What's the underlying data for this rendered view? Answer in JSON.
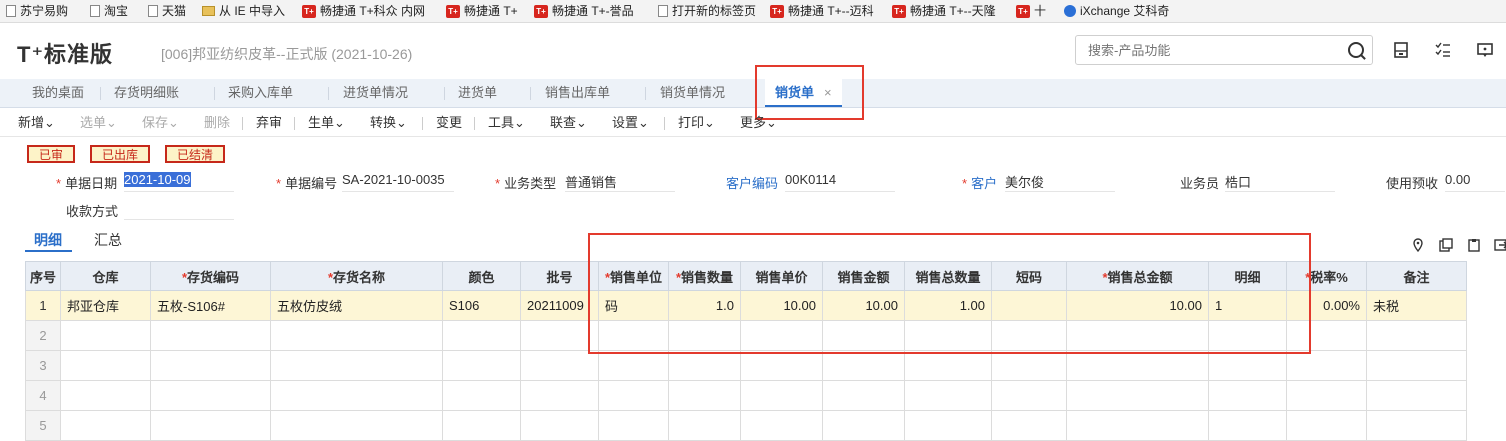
{
  "bookmarks": [
    {
      "label": "苏宁易购",
      "icon": "page-icon"
    },
    {
      "label": "淘宝",
      "icon": "page-icon"
    },
    {
      "label": "天猫",
      "icon": "page-icon"
    },
    {
      "label": "从 IE 中导入",
      "icon": "folder-icon"
    },
    {
      "label": "畅捷通 T+科众 内网",
      "icon": "tplus-icon"
    },
    {
      "label": "畅捷通 T+",
      "icon": "tplus-icon"
    },
    {
      "label": "畅捷通 T+-誉品",
      "icon": "tplus-icon"
    },
    {
      "label": "打开新的标签页",
      "icon": "page-icon"
    },
    {
      "label": "畅捷通 T+--迈科",
      "icon": "tplus-icon"
    },
    {
      "label": "畅捷通 T+--天隆",
      "icon": "tplus-icon"
    },
    {
      "label": "十",
      "icon": "tplus-icon"
    },
    {
      "label": "iXchange 艾科奇",
      "icon": "ixchange-icon"
    }
  ],
  "header": {
    "logo": "T⁺标准版",
    "company": "[006]邦亚纺织皮革--正式版 (2021-10-26)",
    "search_placeholder": "搜索-产品功能"
  },
  "tabs": [
    "我的桌面",
    "存货明细账",
    "采购入库单",
    "进货单情况",
    "进货单",
    "销售出库单",
    "销货单情况",
    "销货单"
  ],
  "active_tab": "销货单",
  "tab_close": "×",
  "toolbar": [
    {
      "label": "新增",
      "disabled": false
    },
    {
      "label": "选单",
      "disabled": true
    },
    {
      "label": "保存",
      "disabled": true
    },
    {
      "label": "删除",
      "disabled": true
    },
    {
      "label": "弃审",
      "disabled": false
    },
    {
      "label": "生单",
      "disabled": false
    },
    {
      "label": "转换",
      "disabled": false
    },
    {
      "label": "变更",
      "disabled": false
    },
    {
      "label": "工具",
      "disabled": false
    },
    {
      "label": "联查",
      "disabled": false
    },
    {
      "label": "设置",
      "disabled": false
    },
    {
      "label": "打印",
      "disabled": false
    },
    {
      "label": "更多",
      "disabled": false
    }
  ],
  "stamps": [
    "已审",
    "已出库",
    "已结清"
  ],
  "form": {
    "date_label": "单据日期",
    "date_value": "2021-10-09",
    "code_label": "单据编号",
    "code_value": "SA-2021-10-0035",
    "biztype_label": "业务类型",
    "biztype_value": "普通销售",
    "custcode_label": "客户编码",
    "custcode_value": "00K0114",
    "customer_label": "客户",
    "customer_value": "美尔俊",
    "salesman_label": "业务员",
    "salesman_value": "梏口",
    "prepay_label": "使用预收",
    "prepay_value": "0.00",
    "payment_label": "收款方式",
    "payment_value": ""
  },
  "subtabs": [
    "明细",
    "汇总"
  ],
  "grid": {
    "columns": [
      {
        "label": "序号",
        "required": false
      },
      {
        "label": "仓库",
        "required": false
      },
      {
        "label": "存货编码",
        "required": true
      },
      {
        "label": "存货名称",
        "required": true
      },
      {
        "label": "颜色",
        "required": false
      },
      {
        "label": "批号",
        "required": false
      },
      {
        "label": "销售单位",
        "required": true
      },
      {
        "label": "销售数量",
        "required": true
      },
      {
        "label": "销售单价",
        "required": false
      },
      {
        "label": "销售金额",
        "required": false
      },
      {
        "label": "销售总数量",
        "required": false
      },
      {
        "label": "短码",
        "required": false
      },
      {
        "label": "销售总金额",
        "required": true
      },
      {
        "label": "明细",
        "required": false
      },
      {
        "label": "税率%",
        "required": true
      },
      {
        "label": "备注",
        "required": false
      }
    ],
    "rows": [
      [
        "1",
        "邦亚仓库",
        "五枚-S106#",
        "五枚仿皮绒",
        "S106",
        "20211009",
        "码",
        "1.0",
        "10.00",
        "10.00",
        "1.00",
        "",
        "10.00",
        "1",
        "0.00%",
        "未税"
      ],
      [
        "2",
        "",
        "",
        "",
        "",
        "",
        "",
        "",
        "",
        "",
        "",
        "",
        "",
        "",
        "",
        ""
      ],
      [
        "3",
        "",
        "",
        "",
        "",
        "",
        "",
        "",
        "",
        "",
        "",
        "",
        "",
        "",
        "",
        ""
      ],
      [
        "4",
        "",
        "",
        "",
        "",
        "",
        "",
        "",
        "",
        "",
        "",
        "",
        "",
        "",
        "",
        ""
      ],
      [
        "5",
        "",
        "",
        "",
        "",
        "",
        "",
        "",
        "",
        "",
        "",
        "",
        "",
        "",
        "",
        ""
      ]
    ]
  },
  "colors": {
    "accent": "#2b6fc9",
    "annotation": "#e33a2d",
    "row_highlight": "#fdf6d6",
    "stamp": "#c6281a"
  }
}
